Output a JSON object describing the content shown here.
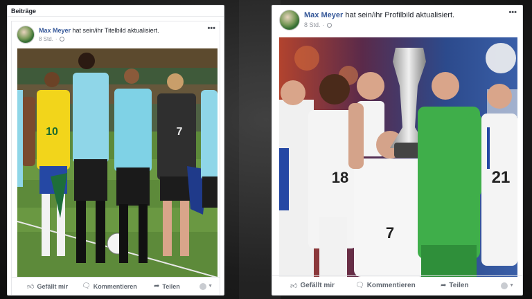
{
  "colors": {
    "link": "#365899",
    "text": "#1d2129",
    "muted": "#90949c",
    "border": "#dddfe2"
  },
  "left_post": {
    "section_title": "Beiträge",
    "author": "Max Meyer",
    "action_text": "hat sein/ihr Titelbild aktualisiert.",
    "time": "8 Std.",
    "more": "•••",
    "like_label": "Gefällt mir",
    "comment_label": "Kommentieren",
    "share_label": "Teilen",
    "icons": {
      "like": "thumbs-up-icon",
      "comment": "speech-bubble-icon",
      "share": "share-arrow-icon",
      "audience": "globe-icon"
    }
  },
  "right_post": {
    "author": "Max Meyer",
    "action_text": "hat sein/ihr Profilbild aktualisiert.",
    "time": "8 Std.",
    "more": "•••",
    "like_label": "Gefällt mir",
    "comment_label": "Kommentieren",
    "share_label": "Teilen",
    "icons": {
      "like": "thumbs-up-icon",
      "comment": "speech-bubble-icon",
      "share": "share-arrow-icon",
      "audience": "globe-icon"
    }
  },
  "photo_text": {
    "left_jersey_yellow": "10",
    "left_jersey_black": "7",
    "right_jersey_keeper": "21",
    "right_jersey_mid": "18",
    "right_jersey_center": "7"
  }
}
